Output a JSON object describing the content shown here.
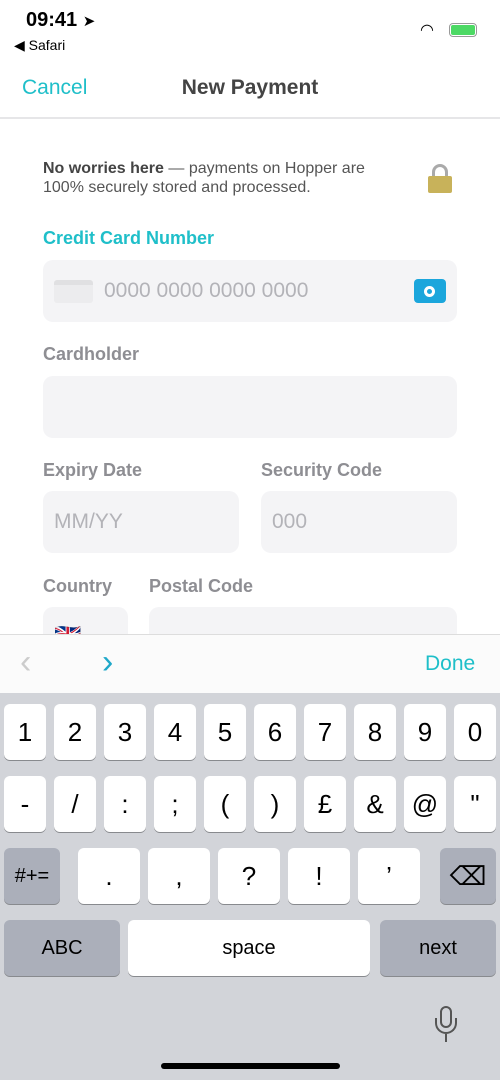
{
  "status": {
    "time": "09:41",
    "back_app": "Safari"
  },
  "nav": {
    "cancel": "Cancel",
    "title": "New Payment"
  },
  "notice": {
    "bold": "No worries here",
    "text": " — payments on Hopper are 100% securely stored and processed."
  },
  "card": {
    "label": "Credit Card Number",
    "placeholder": "0000 0000 0000 0000"
  },
  "holder": {
    "label": "Cardholder",
    "value": ""
  },
  "expiry": {
    "label": "Expiry Date",
    "placeholder": "MM/YY"
  },
  "cvv": {
    "label": "Security Code",
    "placeholder": "000"
  },
  "country": {
    "label": "Country",
    "flag": "🇬🇧"
  },
  "postal": {
    "label": "Postal Code",
    "value": ""
  },
  "toolbar": {
    "done": "Done",
    "prev": "‹",
    "next": "›"
  },
  "keyboard": {
    "row1": [
      "1",
      "2",
      "3",
      "4",
      "5",
      "6",
      "7",
      "8",
      "9",
      "0"
    ],
    "row2": [
      "-",
      "/",
      ":",
      ";",
      "(",
      ")",
      "£",
      "&",
      "@",
      "\""
    ],
    "row3": [
      "#+=",
      ".",
      ",",
      "?",
      "!",
      "’"
    ],
    "abc": "ABC",
    "space": "space",
    "next": "next"
  },
  "colors": {
    "accent": "#1fbfc9",
    "camera": "#1ba6dc"
  }
}
